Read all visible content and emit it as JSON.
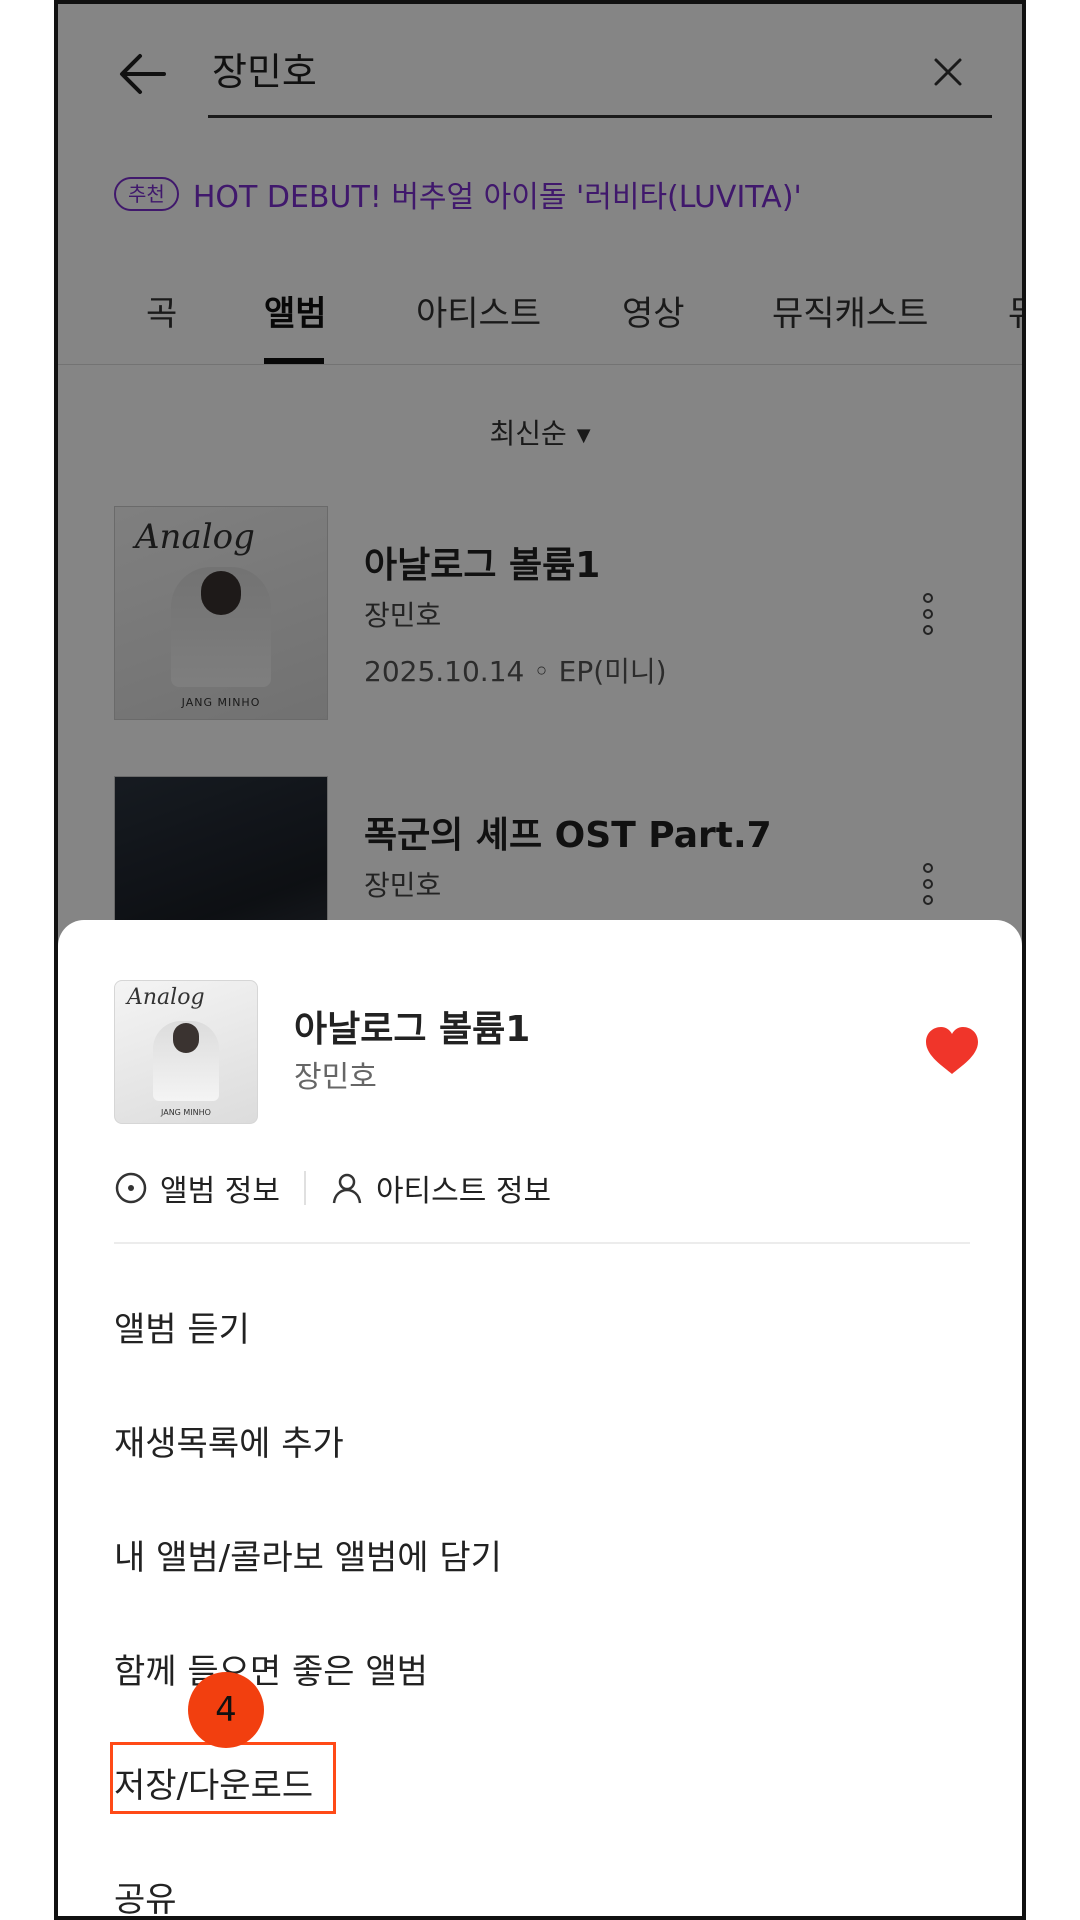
{
  "search": {
    "query": "장민호"
  },
  "recommend": {
    "badge": "추천",
    "text": "HOT DEBUT! 버추얼 아이돌 '러비타(LUVITA)'"
  },
  "tabs": [
    {
      "label": "곡"
    },
    {
      "label": "앨범"
    },
    {
      "label": "아티스트"
    },
    {
      "label": "영상"
    },
    {
      "label": "뮤직캐스트"
    },
    {
      "label": "뮤"
    }
  ],
  "sort": {
    "label": "최신순"
  },
  "albums": [
    {
      "title": "아날로그 볼륨1",
      "artist": "장민호",
      "meta": "2025.10.14 ◦ EP(미니)",
      "cover_logo": "Analog",
      "cover_footer": "JANG MINHO"
    },
    {
      "title": "폭군의 셰프 OST Part.7",
      "artist": "장민호"
    }
  ],
  "sheet": {
    "title": "아날로그 볼륨1",
    "artist": "장민호",
    "cover_logo": "Analog",
    "cover_footer": "JANG MINHO",
    "liked": true,
    "album_info": "앨범 정보",
    "artist_info": "아티스트 정보",
    "menu": [
      {
        "label": "앨범 듣기"
      },
      {
        "label": "재생목록에 추가"
      },
      {
        "label": "내 앨범/콜라보 앨범에 담기"
      },
      {
        "label": "함께 들으면 좋은 앨범"
      },
      {
        "label": "저장/다운로드"
      },
      {
        "label": "공유"
      }
    ]
  },
  "annotation": {
    "step_number": "4"
  },
  "colors": {
    "accent_purple": "#7b2fd0",
    "heart": "#f0352a",
    "highlight": "#ff4a17"
  }
}
